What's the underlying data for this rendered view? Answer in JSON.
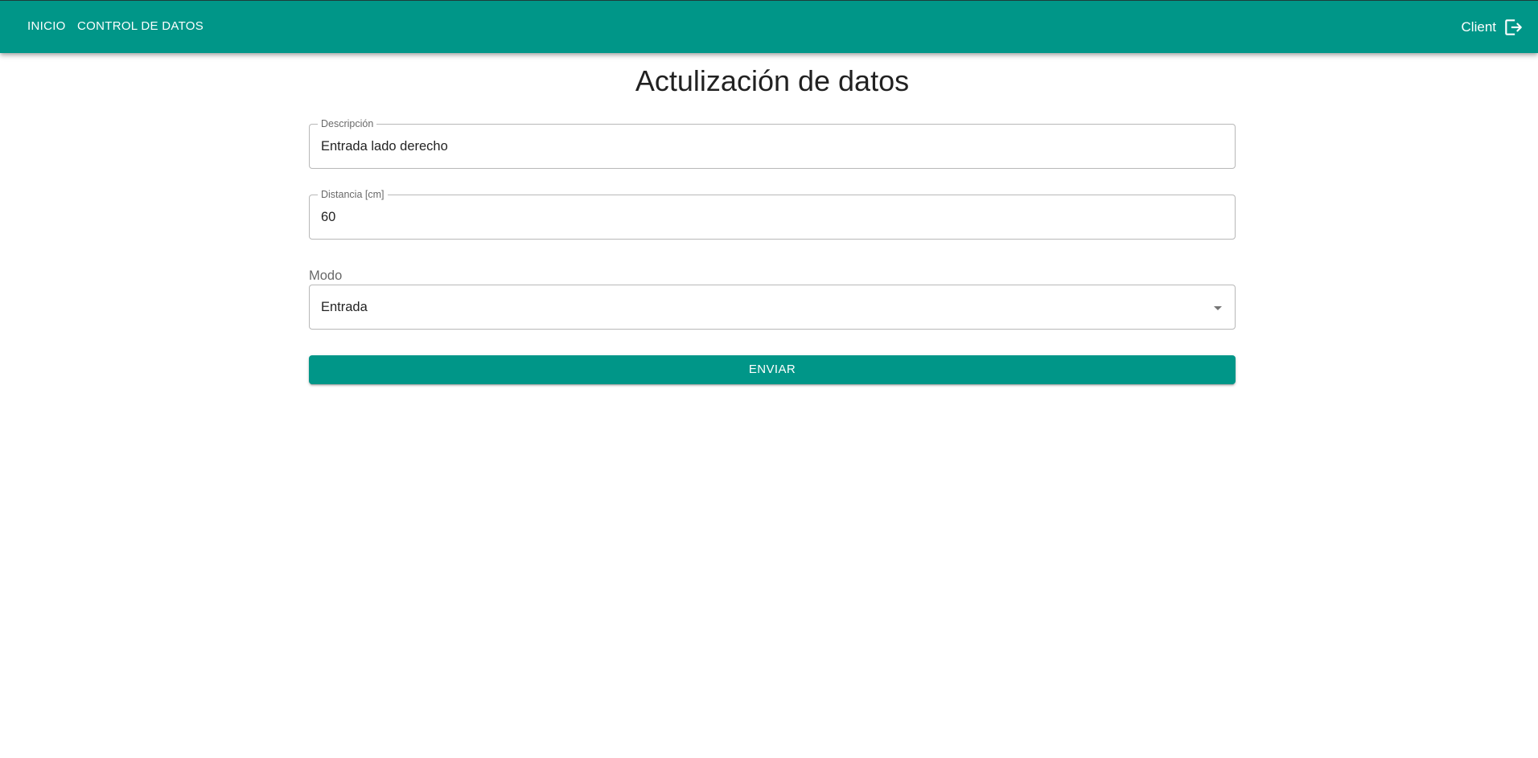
{
  "nav": {
    "home_label": "INICIO",
    "data_control_label": "CONTROL DE DATOS"
  },
  "user": {
    "name": "Client",
    "logout_icon": "logout-icon"
  },
  "page": {
    "title": "Actulización de datos"
  },
  "form": {
    "description": {
      "label": "Descripción",
      "value": "Entrada lado derecho"
    },
    "distance": {
      "label": "Distancia [cm]",
      "value": "60"
    },
    "mode": {
      "label": "Modo",
      "selected": "Entrada"
    },
    "submit_label": "ENVIAR"
  },
  "colors": {
    "primary": "#009688",
    "appbar_text": "#ffffff"
  }
}
